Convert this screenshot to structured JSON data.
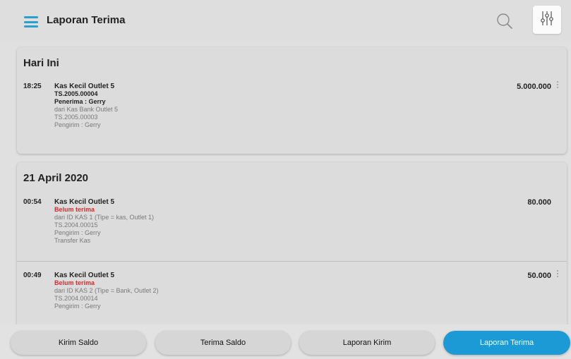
{
  "header": {
    "title": "Laporan Terima",
    "menu_icon": "hamburger-menu-icon",
    "search_icon": "search-icon",
    "filter_icon": "sliders-filter-icon"
  },
  "sections": [
    {
      "title": "Hari Ini",
      "entries": [
        {
          "time": "18:25",
          "name": "Kas Kecil Outlet 5",
          "line1": "TS.2005.00004",
          "line2": "Penerima : Gerry",
          "line3": "dari Kas Bank Outlet 5",
          "line4": "TS.2005.00003",
          "line5": "Pengirim : Gerry",
          "amount": "5.000.000"
        }
      ]
    },
    {
      "title": "21 April 2020",
      "entries": [
        {
          "time": "00:54",
          "name": "Kas Kecil Outlet 5",
          "status": "Belum terima",
          "line1": "dari ID KAS 1 (Tipe = kas, Outlet 1)",
          "line2": "TS.2004.00015",
          "line3": "Pengirim : Gerry",
          "line4": "Transfer Kas",
          "amount": "80.000"
        },
        {
          "time": "00:49",
          "name": "Kas Kecil Outlet 5",
          "status": "Belum terima",
          "line1": "dari ID KAS 2 (Tipe = Bank, Outlet 2)",
          "line2": "TS.2004.00014",
          "line3": "Pengirim : Gerry",
          "amount": "50.000"
        }
      ]
    }
  ],
  "bottom_nav": [
    {
      "label": "Kirim Saldo"
    },
    {
      "label": "Terima Saldo"
    },
    {
      "label": "Laporan Kirim"
    },
    {
      "label": "Laporan Terima"
    }
  ],
  "colors": {
    "accent": "#1b9ad6",
    "status_red": "#d32f2f",
    "menu_blue": "#2a9fd0"
  }
}
